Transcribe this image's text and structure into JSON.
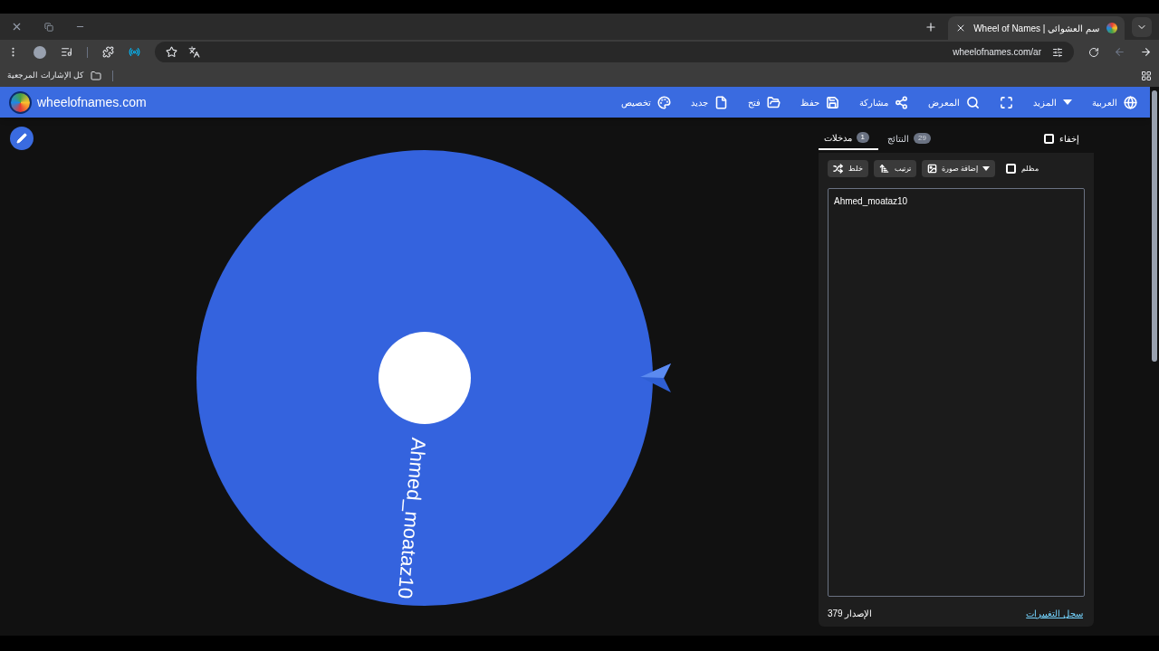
{
  "browser": {
    "tabs": [
      {
        "title": "Wheel of Names | سم العشوائي",
        "selected": true
      }
    ],
    "url": "wheelofnames.com/ar",
    "bookmarks_label": "كل الإشارات المرجعية"
  },
  "header": {
    "logo_text": "wheelofnames.com",
    "menu": [
      {
        "kind": "globe",
        "label": "العربية"
      },
      {
        "kind": "caret",
        "label": "المزيد"
      },
      {
        "kind": "fullscreen"
      },
      {
        "kind": "search",
        "label": "المعرض"
      },
      {
        "kind": "share",
        "label": "مشاركة"
      },
      {
        "kind": "save",
        "label": "حفظ"
      },
      {
        "kind": "open",
        "label": "فتح"
      },
      {
        "kind": "new",
        "label": "جديد"
      },
      {
        "kind": "palette",
        "label": "تخصيص"
      }
    ]
  },
  "wheel": {
    "segments": [
      {
        "text": "Ahmed_moataz10",
        "color": "#3463de"
      }
    ]
  },
  "panel": {
    "hide": {
      "label": "إخفاء",
      "checked": false
    },
    "tabs": [
      {
        "label": "النتائج",
        "count": "29",
        "selected": false
      },
      {
        "label": "مدخلات",
        "count": "1",
        "selected": true
      }
    ],
    "dark": {
      "label": "مظلم",
      "checked": false
    },
    "image_button": "إضافة صورة",
    "sort_button": "ترتيب",
    "shuffle_button": "خلط",
    "entries": "Ahmed_moataz10",
    "version": "379 الإصدار",
    "changelog": "سجل التغييرات"
  }
}
